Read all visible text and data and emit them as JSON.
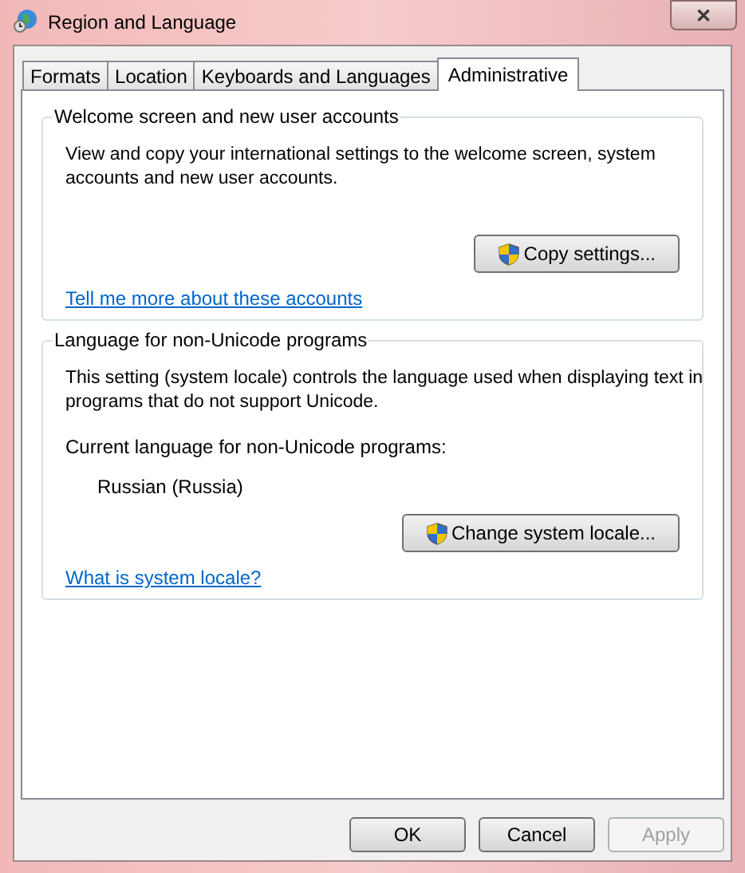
{
  "window": {
    "title": "Region and Language",
    "close": "✕"
  },
  "tabs": [
    {
      "label": "Formats",
      "selected": false
    },
    {
      "label": "Location",
      "selected": false
    },
    {
      "label": "Keyboards and Languages",
      "selected": false
    },
    {
      "label": "Administrative",
      "selected": true
    }
  ],
  "groups": [
    {
      "title": "Welcome screen and new user accounts",
      "description": "View and copy your international settings to the welcome screen, system accounts and new user accounts.",
      "button": "Copy settings...",
      "link": "Tell me more about these accounts"
    },
    {
      "title": "Language for non-Unicode programs",
      "description": "This setting (system locale) controls the language used when displaying text in programs that do not support Unicode.",
      "current_label": "Current language for non-Unicode programs:",
      "current_value": "Russian (Russia)",
      "button": "Change system locale...",
      "link": "What is system locale?"
    }
  ],
  "buttons": [
    {
      "label": "OK",
      "disabled": false
    },
    {
      "label": "Cancel",
      "disabled": false
    },
    {
      "label": "Apply",
      "disabled": true
    }
  ]
}
